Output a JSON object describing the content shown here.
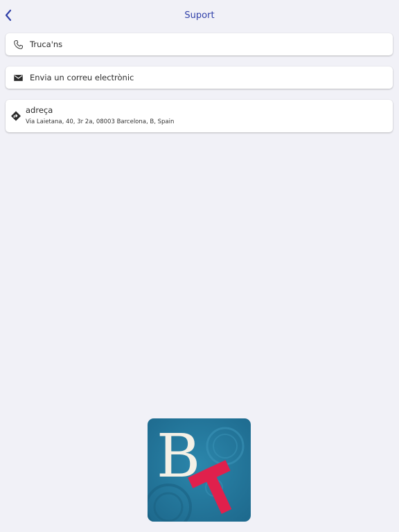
{
  "header": {
    "title": "Suport"
  },
  "contacts": {
    "call_label": "Truca'ns",
    "email_label": "Envia un correu electrònic",
    "address_label": "adreça",
    "address_value": "Via Laietana, 40, 3r 2a, 08003 Barcelona, B, Spain"
  },
  "logo": {
    "letter_b": "B",
    "letter_t": "T"
  },
  "icons": {
    "back": "chevron-left-icon",
    "call": "phone-icon",
    "email": "mail-icon",
    "address": "directions-icon"
  },
  "colors": {
    "accent": "#2f3fa8",
    "logo_background": "#2a7fa3",
    "logo_t": "#e0204c",
    "logo_b": "#f4f0e6"
  }
}
